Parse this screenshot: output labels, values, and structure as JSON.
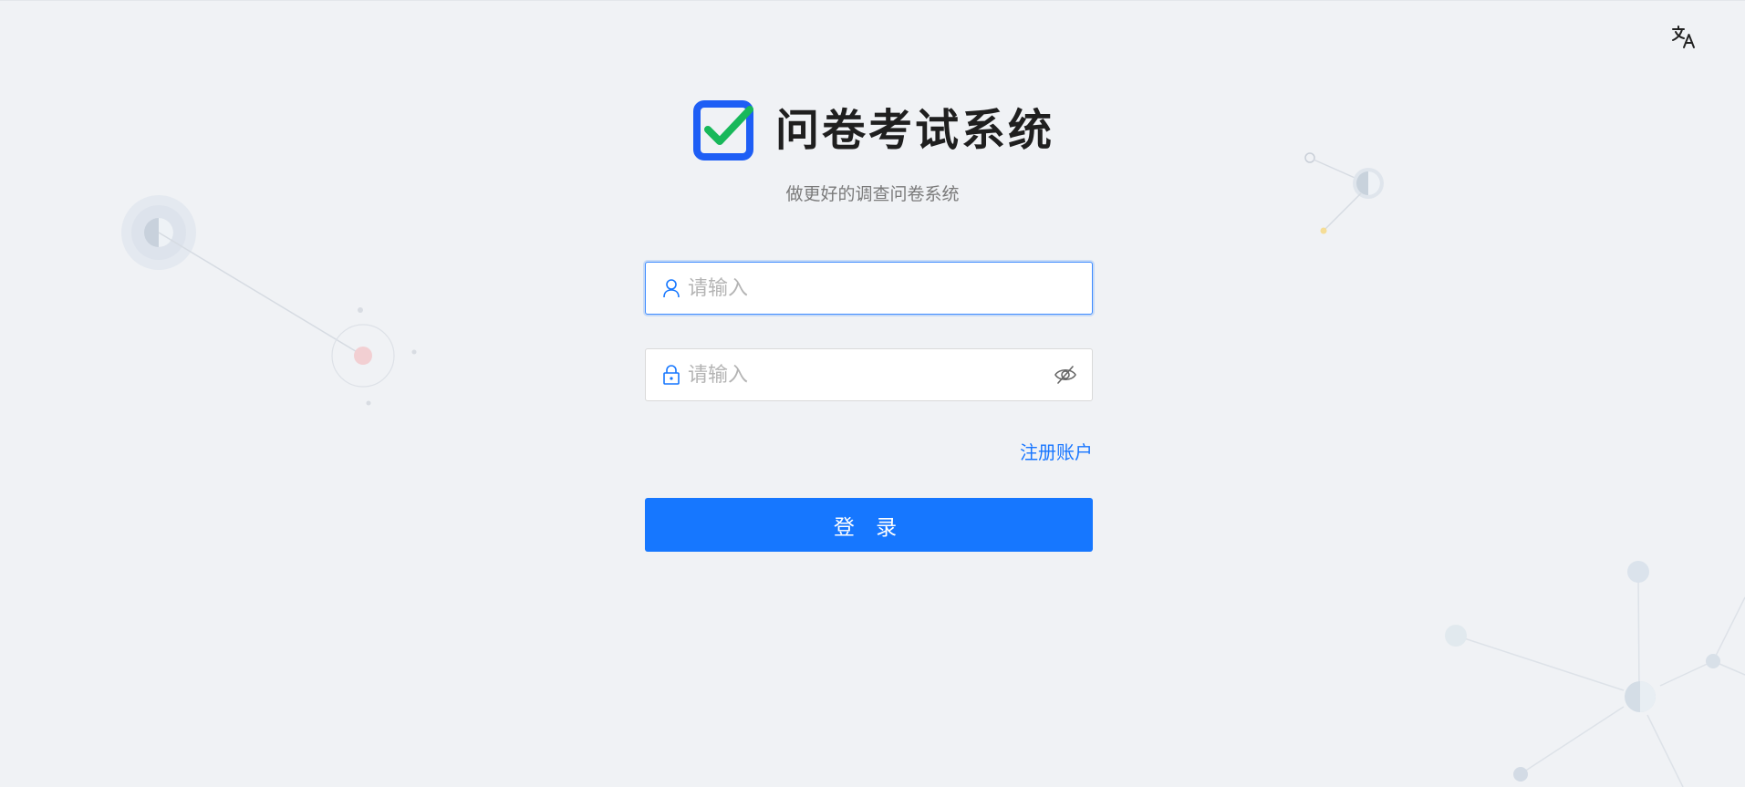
{
  "app": {
    "title": "问卷考试系统",
    "subtitle": "做更好的调查问卷系统"
  },
  "language_switch": {
    "icon": "translate-icon"
  },
  "login_form": {
    "username": {
      "placeholder": "请输入",
      "value": "",
      "icon": "user-icon"
    },
    "password": {
      "placeholder": "请输入",
      "value": "",
      "icon": "lock-icon",
      "toggle_icon": "eye-off-icon"
    },
    "register_link": "注册账户",
    "submit_label": "登 录"
  },
  "colors": {
    "primary": "#1677ff",
    "link": "#1876ff",
    "logo_blue": "#1e5ef5",
    "logo_check": "#18b85a",
    "background": "#f0f2f5"
  }
}
